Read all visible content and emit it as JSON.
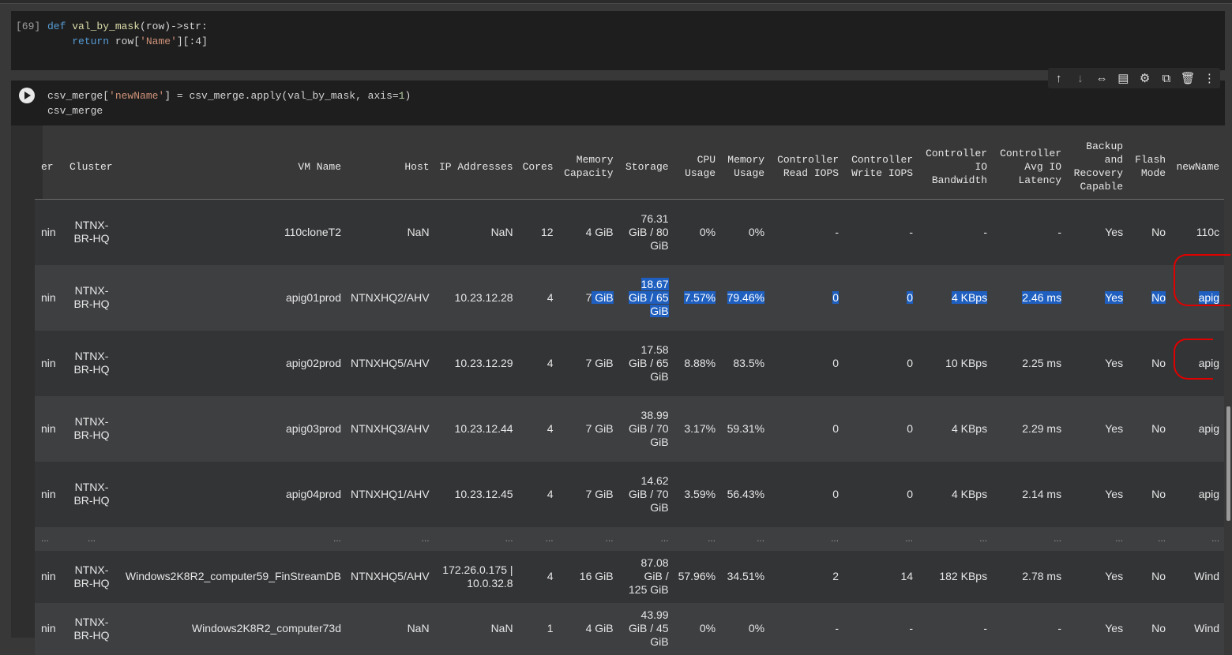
{
  "cell1": {
    "prompt": "[69]",
    "def_kw": "def",
    "func": "val_by_mask",
    "params": "(row)->str:",
    "return_kw": "return",
    "ret_expr_a": "row[",
    "ret_str": "'Name'",
    "ret_expr_b": "][:4]"
  },
  "cell2": {
    "line1_a": "csv_merge[",
    "line1_str": "'newName'",
    "line1_b": "] = csv_merge.apply(val_by_mask, axis=",
    "line1_num": "1",
    "line1_c": ")",
    "line2": "csv_merge"
  },
  "toolbar": {
    "icons": [
      "arrow-up-icon",
      "arrow-down-icon",
      "link-icon",
      "comment-icon",
      "gear-icon",
      "mirror-cell-icon",
      "trash-icon",
      "more-icon"
    ],
    "glyphs": [
      "↑",
      "↓",
      "⇔",
      "▤",
      "⚙",
      "⧉",
      "🗑",
      "⋮"
    ]
  },
  "table": {
    "headers": [
      "er",
      "Cluster",
      "VM Name",
      "Host",
      "IP Addresses",
      "Cores",
      "Memory Capacity",
      "Storage",
      "CPU Usage",
      "Memory Usage",
      "Controller Read IOPS",
      "Controller Write IOPS",
      "Controller IO Bandwidth",
      "Controller Avg IO Latency",
      "Backup and Recovery Capable",
      "Flash Mode",
      "newName"
    ],
    "rows": [
      {
        "c0": "nin",
        "cluster": "NTNX-BR-HQ",
        "vm": "110cloneT2",
        "host": "NaN",
        "ip": "NaN",
        "cores": "12",
        "mem": "4 GiB",
        "storage": "76.31 GiB / 80 GiB",
        "cpu": "0%",
        "memu": "0%",
        "rd": "-",
        "wr": "-",
        "bw": "-",
        "lat": "-",
        "bk": "Yes",
        "fl": "No",
        "nn": "110c"
      },
      {
        "c0": "nin",
        "cluster": "NTNX-BR-HQ",
        "vm": "apig01prod",
        "host": "NTNXHQ2/AHV",
        "ip": "10.23.12.28",
        "cores": "4",
        "mem_a": "7",
        "mem_b": " GiB",
        "storage": "18.67 GiB / 65 GiB",
        "cpu": "7.57%",
        "memu": "79.46%",
        "rd": "0",
        "wr": "0",
        "bw": "4 KBps",
        "lat": "2.46 ms",
        "bk": "Yes",
        "fl": "No",
        "nn": "apig"
      },
      {
        "c0": "nin",
        "cluster": "NTNX-BR-HQ",
        "vm": "apig02prod",
        "host": "NTNXHQ5/AHV",
        "ip": "10.23.12.29",
        "cores": "4",
        "mem": "7 GiB",
        "storage": "17.58 GiB / 65 GiB",
        "cpu": "8.88%",
        "memu": "83.5%",
        "rd": "0",
        "wr": "0",
        "bw": "10 KBps",
        "lat": "2.25 ms",
        "bk": "Yes",
        "fl": "No",
        "nn": "apig"
      },
      {
        "c0": "nin",
        "cluster": "NTNX-BR-HQ",
        "vm": "apig03prod",
        "host": "NTNXHQ3/AHV",
        "ip": "10.23.12.44",
        "cores": "4",
        "mem": "7 GiB",
        "storage": "38.99 GiB / 70 GiB",
        "cpu": "3.17%",
        "memu": "59.31%",
        "rd": "0",
        "wr": "0",
        "bw": "4 KBps",
        "lat": "2.29 ms",
        "bk": "Yes",
        "fl": "No",
        "nn": "apig"
      },
      {
        "c0": "nin",
        "cluster": "NTNX-BR-HQ",
        "vm": "apig04prod",
        "host": "NTNXHQ1/AHV",
        "ip": "10.23.12.45",
        "cores": "4",
        "mem": "7 GiB",
        "storage": "14.62 GiB / 70 GiB",
        "cpu": "3.59%",
        "memu": "56.43%",
        "rd": "0",
        "wr": "0",
        "bw": "4 KBps",
        "lat": "2.14 ms",
        "bk": "Yes",
        "fl": "No",
        "nn": "apig"
      },
      {
        "c0": "nin",
        "cluster": "NTNX-BR-HQ",
        "vm": "Windows2K8R2_computer59_FinStreamDB",
        "host": "NTNXHQ5/AHV",
        "ip": "172.26.0.175 | 10.0.32.8",
        "cores": "4",
        "mem": "16 GiB",
        "storage": "87.08 GiB / 125 GiB",
        "cpu": "57.96%",
        "memu": "34.51%",
        "rd": "2",
        "wr": "14",
        "bw": "182 KBps",
        "lat": "2.78 ms",
        "bk": "Yes",
        "fl": "No",
        "nn": "Wind"
      },
      {
        "c0": "nin",
        "cluster": "NTNX-BR-HQ",
        "vm": "Windows2K8R2_computer73d",
        "host": "NaN",
        "ip": "NaN",
        "cores": "1",
        "mem": "4 GiB",
        "storage": "43.99 GiB / 45 GiB",
        "cpu": "0%",
        "memu": "0%",
        "rd": "-",
        "wr": "-",
        "bw": "-",
        "lat": "-",
        "bk": "Yes",
        "fl": "No",
        "nn": "Wind"
      }
    ],
    "ellipsis": "..."
  },
  "colors": {
    "highlight": "#1f5fbf",
    "annotation": "#e00000"
  }
}
